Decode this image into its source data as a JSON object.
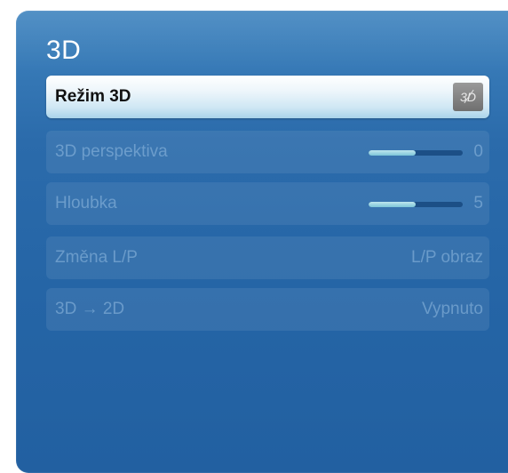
{
  "menu": {
    "title": "3D",
    "items": [
      {
        "label": "Režim 3D",
        "value": "3D",
        "selected": true,
        "icon": "3d-off-icon"
      },
      {
        "label": "3D perspektiva",
        "value": "0",
        "slider_fraction": 0.5
      },
      {
        "label": "Hloubka",
        "value": "5",
        "slider_fraction": 0.5
      },
      {
        "label": "Změna L/P",
        "value": "L/P obraz"
      },
      {
        "label": "3D → 2D",
        "value": "Vypnuto"
      }
    ]
  }
}
